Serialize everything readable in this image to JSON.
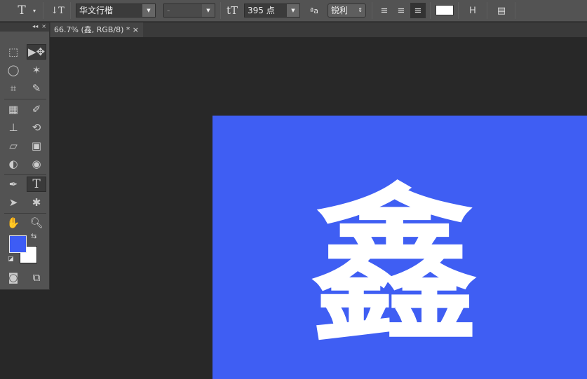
{
  "options_bar": {
    "tool_icon": "type-tool-icon",
    "font_family": "华文行楷",
    "font_style": "-",
    "font_size": "395 点",
    "antialias": "锐利",
    "text_color": "#ffffff",
    "alignment": "right"
  },
  "document_tab": {
    "title": "66.7% (鑫, RGB/8) *",
    "close": "×"
  },
  "tools_panel": {
    "collapse": "◂◂",
    "close": "×",
    "foreground_color": "#3d5cf5",
    "background_color": "#ffffff",
    "active_tool": "type"
  },
  "canvas": {
    "background": "#3f5ef3",
    "text": "鑫"
  }
}
